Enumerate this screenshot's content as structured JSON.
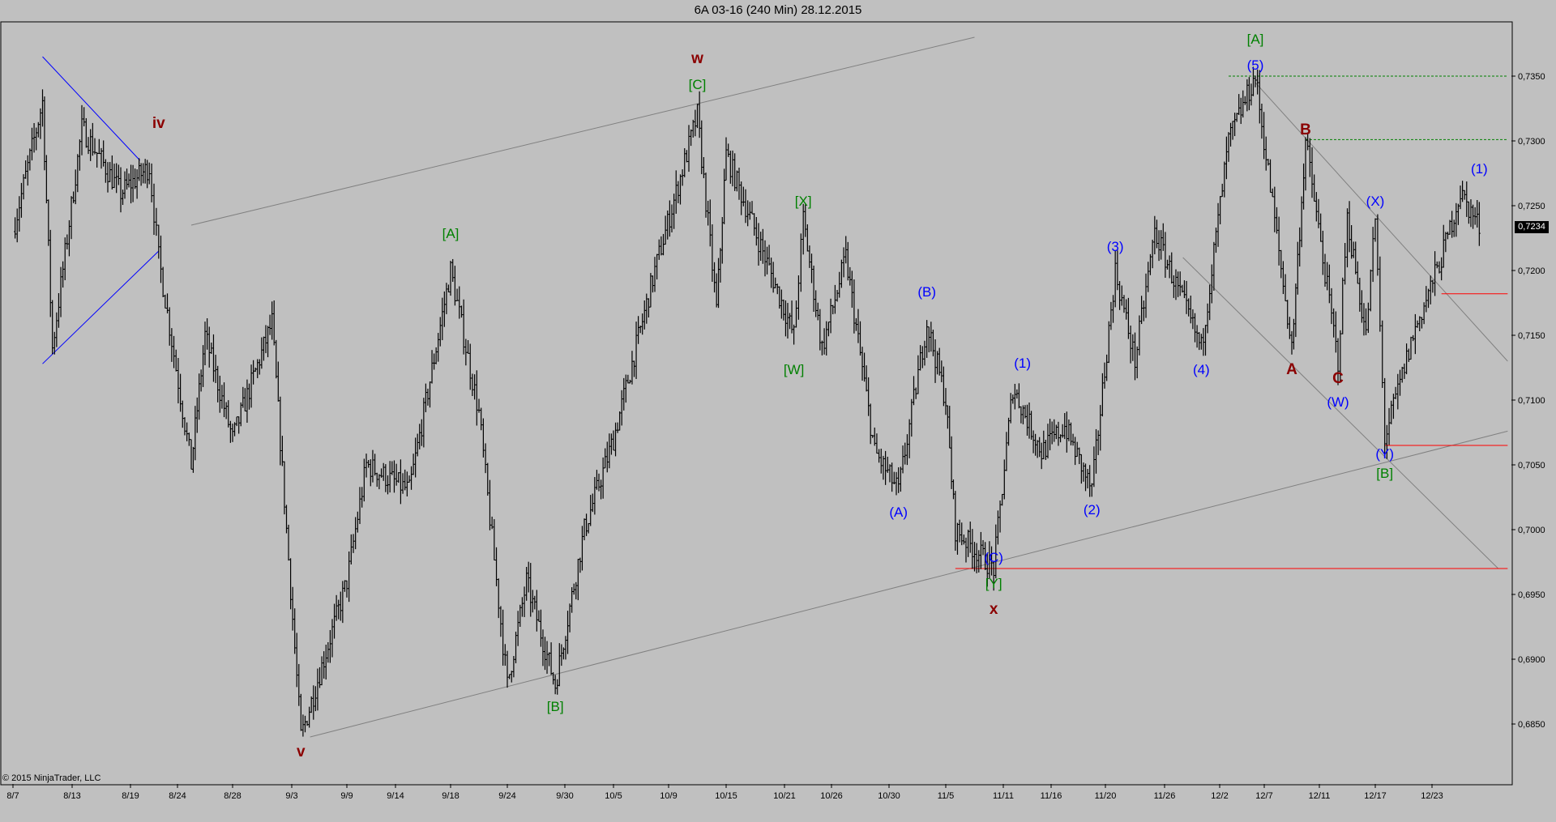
{
  "window": {
    "title": "6A 03-16 (240 Min)  28.12.2015"
  },
  "footer": {
    "copyright": "© 2015 NinjaTrader, LLC"
  },
  "colors": {
    "background": "#c0c0c0",
    "bars": "#000000",
    "blue_label": "#0000ff",
    "green_label": "#008000",
    "darkred_label": "#8b0000",
    "channel": "#808080",
    "triangle": "#0000ff",
    "support": "#ff0000",
    "target": "#008000"
  },
  "chart_data": {
    "type": "ohlc",
    "title": "6A 03-16 (240 Min)  28.12.2015",
    "x_ticks": [
      "8/7",
      "8/13",
      "8/19",
      "8/24",
      "8/28",
      "9/3",
      "9/9",
      "9/14",
      "9/18",
      "9/24",
      "9/30",
      "10/5",
      "10/9",
      "10/15",
      "10/21",
      "10/26",
      "10/30",
      "11/5",
      "11/11",
      "11/16",
      "11/20",
      "11/26",
      "12/2",
      "12/7",
      "12/11",
      "12/17",
      "12/23"
    ],
    "y_ticks": [
      "0,7350",
      "0,7300",
      "0,7250",
      "0,7200",
      "0,7150",
      "0,7100",
      "0,7050",
      "0,7000",
      "0,6950",
      "0,6900",
      "0,6850"
    ],
    "ylim": [
      0.68,
      0.738
    ],
    "last_price": "0,7234",
    "swings": [
      {
        "t": "8/7",
        "p": 0.723
      },
      {
        "t": "8/10",
        "p": 0.733
      },
      {
        "t": "8/11",
        "p": 0.714
      },
      {
        "t": "8/14",
        "p": 0.731
      },
      {
        "t": "8/18",
        "p": 0.726
      },
      {
        "t": "8/21",
        "p": 0.728
      },
      {
        "t": "8/22",
        "p": 0.721
      },
      {
        "t": "8/25",
        "p": 0.705
      },
      {
        "t": "8/26",
        "p": 0.715
      },
      {
        "t": "8/28",
        "p": 0.707
      },
      {
        "t": "9/1",
        "p": 0.716
      },
      {
        "t": "9/4",
        "p": 0.684
      },
      {
        "t": "9/9",
        "p": 0.696
      },
      {
        "t": "9/11",
        "p": 0.705
      },
      {
        "t": "9/15",
        "p": 0.703
      },
      {
        "t": "9/18",
        "p": 0.72
      },
      {
        "t": "9/21",
        "p": 0.709
      },
      {
        "t": "9/24",
        "p": 0.688
      },
      {
        "t": "9/26",
        "p": 0.696
      },
      {
        "t": "9/29",
        "p": 0.688
      },
      {
        "t": "10/2",
        "p": 0.7
      },
      {
        "t": "10/5",
        "p": 0.707
      },
      {
        "t": "10/8",
        "p": 0.72
      },
      {
        "t": "10/12",
        "p": 0.732
      },
      {
        "t": "10/14",
        "p": 0.717
      },
      {
        "t": "10/15",
        "p": 0.729
      },
      {
        "t": "10/19",
        "p": 0.721
      },
      {
        "t": "10/22",
        "p": 0.715
      },
      {
        "t": "10/23",
        "p": 0.724
      },
      {
        "t": "10/25",
        "p": 0.714
      },
      {
        "t": "10/27",
        "p": 0.721
      },
      {
        "t": "10/29",
        "p": 0.706
      },
      {
        "t": "10/31",
        "p": 0.703
      },
      {
        "t": "11/3",
        "p": 0.716
      },
      {
        "t": "11/5",
        "p": 0.71
      },
      {
        "t": "11/6",
        "p": 0.7
      },
      {
        "t": "11/10",
        "p": 0.697
      },
      {
        "t": "11/12",
        "p": 0.711
      },
      {
        "t": "11/15",
        "p": 0.706
      },
      {
        "t": "11/17",
        "p": 0.708
      },
      {
        "t": "11/19",
        "p": 0.703
      },
      {
        "t": "11/21",
        "p": 0.72
      },
      {
        "t": "11/23",
        "p": 0.713
      },
      {
        "t": "11/25",
        "p": 0.723
      },
      {
        "t": "11/30",
        "p": 0.714
      },
      {
        "t": "12/3",
        "p": 0.73
      },
      {
        "t": "12/6",
        "p": 0.735
      },
      {
        "t": "12/9",
        "p": 0.714
      },
      {
        "t": "12/10",
        "p": 0.73
      },
      {
        "t": "12/13",
        "p": 0.713
      },
      {
        "t": "12/14",
        "p": 0.724
      },
      {
        "t": "12/16",
        "p": 0.715
      },
      {
        "t": "12/17",
        "p": 0.724
      },
      {
        "t": "12/18",
        "p": 0.707
      },
      {
        "t": "12/21",
        "p": 0.715
      },
      {
        "t": "12/24",
        "p": 0.721
      },
      {
        "t": "12/26",
        "p": 0.726
      },
      {
        "t": "12/28",
        "p": 0.7234
      }
    ],
    "wave_labels": [
      {
        "text": "iv",
        "t": "8/22",
        "p": 0.731,
        "color": "darkred",
        "bold": true
      },
      {
        "text": "v",
        "t": "9/4",
        "p": 0.6825,
        "color": "darkred",
        "bold": true
      },
      {
        "text": "w",
        "t": "10/12",
        "p": 0.736,
        "color": "darkred",
        "bold": true
      },
      {
        "text": "x",
        "t": "11/10",
        "p": 0.6935,
        "color": "darkred",
        "bold": true
      },
      {
        "text": "[A]",
        "t": "9/18",
        "p": 0.7225,
        "color": "green",
        "bold": false
      },
      {
        "text": "[B]",
        "t": "9/29",
        "p": 0.686,
        "color": "green",
        "bold": false
      },
      {
        "text": "[C]",
        "t": "10/12",
        "p": 0.734,
        "color": "green",
        "bold": false
      },
      {
        "text": "[X]",
        "t": "10/23",
        "p": 0.725,
        "color": "green",
        "bold": false
      },
      {
        "text": "[W]",
        "t": "10/22",
        "p": 0.712,
        "color": "green",
        "bold": false
      },
      {
        "text": "[Y]",
        "t": "11/10",
        "p": 0.6955,
        "color": "green",
        "bold": false
      },
      {
        "text": "[A]",
        "t": "12/6",
        "p": 0.7375,
        "color": "green",
        "bold": false
      },
      {
        "text": "[B]",
        "t": "12/18",
        "p": 0.704,
        "color": "green",
        "bold": false
      },
      {
        "text": "(A)",
        "t": "10/31",
        "p": 0.701,
        "color": "blue",
        "bold": false
      },
      {
        "text": "(B)",
        "t": "11/3",
        "p": 0.718,
        "color": "blue",
        "bold": false
      },
      {
        "text": "(C)",
        "t": "11/10",
        "p": 0.6975,
        "color": "blue",
        "bold": false
      },
      {
        "text": "(1)",
        "t": "11/13",
        "p": 0.7125,
        "color": "blue",
        "bold": false
      },
      {
        "text": "(2)",
        "t": "11/19",
        "p": 0.7012,
        "color": "blue",
        "bold": false
      },
      {
        "text": "(3)",
        "t": "11/21",
        "p": 0.7215,
        "color": "blue",
        "bold": false
      },
      {
        "text": "(4)",
        "t": "11/30",
        "p": 0.712,
        "color": "blue",
        "bold": false
      },
      {
        "text": "(5)",
        "t": "12/6",
        "p": 0.7355,
        "color": "blue",
        "bold": false
      },
      {
        "text": "(W)",
        "t": "12/13",
        "p": 0.7095,
        "color": "blue",
        "bold": false
      },
      {
        "text": "(X)",
        "t": "12/17",
        "p": 0.725,
        "color": "blue",
        "bold": false
      },
      {
        "text": "(Y)",
        "t": "12/18",
        "p": 0.7055,
        "color": "blue",
        "bold": false
      },
      {
        "text": "(1)",
        "t": "12/28",
        "p": 0.7275,
        "color": "blue",
        "bold": false
      },
      {
        "text": "A",
        "t": "12/9",
        "p": 0.712,
        "color": "darkred",
        "bold": true
      },
      {
        "text": "B",
        "t": "12/10",
        "p": 0.7305,
        "color": "darkred",
        "bold": true
      },
      {
        "text": "C",
        "t": "12/13",
        "p": 0.7113,
        "color": "darkred",
        "bold": true
      }
    ],
    "lines": [
      {
        "kind": "channel",
        "from": {
          "t": "8/25",
          "p": 0.7235
        },
        "to": {
          "t": "11/8",
          "p": 0.738
        }
      },
      {
        "kind": "channel",
        "from": {
          "t": "9/5",
          "p": 0.684
        },
        "to": {
          "t": "12/31",
          "p": 0.7076
        }
      },
      {
        "kind": "channel",
        "from": {
          "t": "12/6",
          "p": 0.7345
        },
        "to": {
          "t": "12/31",
          "p": 0.713
        }
      },
      {
        "kind": "channel",
        "from": {
          "t": "11/28",
          "p": 0.721
        },
        "to": {
          "t": "12/30",
          "p": 0.697
        }
      },
      {
        "kind": "triangle",
        "from": {
          "t": "8/10",
          "p": 0.7365
        },
        "to": {
          "t": "8/20",
          "p": 0.7285
        }
      },
      {
        "kind": "triangle",
        "from": {
          "t": "8/10",
          "p": 0.7128
        },
        "to": {
          "t": "8/22",
          "p": 0.7215
        }
      },
      {
        "kind": "support",
        "from": {
          "t": "11/6",
          "p": 0.697
        },
        "to": {
          "t": "12/31",
          "p": 0.697
        }
      },
      {
        "kind": "support",
        "from": {
          "t": "12/18",
          "p": 0.7065
        },
        "to": {
          "t": "12/31",
          "p": 0.7065
        }
      },
      {
        "kind": "support",
        "from": {
          "t": "12/24",
          "p": 0.7182
        },
        "to": {
          "t": "12/31",
          "p": 0.7182
        }
      },
      {
        "kind": "target",
        "from": {
          "t": "12/3",
          "p": 0.735
        },
        "to": {
          "t": "12/31",
          "p": 0.735
        }
      },
      {
        "kind": "target",
        "from": {
          "t": "12/10",
          "p": 0.7301
        },
        "to": {
          "t": "12/31",
          "p": 0.7301
        }
      }
    ]
  }
}
